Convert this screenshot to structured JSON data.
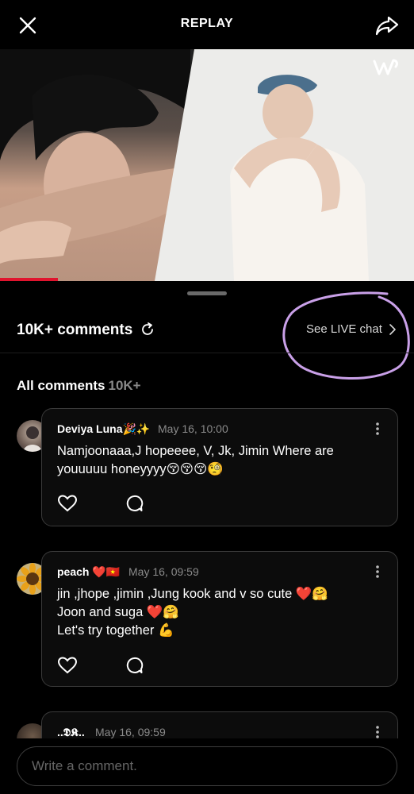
{
  "header": {
    "title": "REPLAY",
    "close_icon": "close-icon",
    "share_icon": "share-icon"
  },
  "video": {
    "logo_icon": "weverse-logo-icon",
    "progress": 0.14
  },
  "comments_section": {
    "count_label": "10K+ comments",
    "refresh_icon": "refresh-icon",
    "live_chat_label": "See LIVE chat",
    "all_comments_label": "All comments",
    "all_comments_count": "10K+"
  },
  "comments": [
    {
      "author": "Deviya Luna🎉✨",
      "date": "May 16, 10:00",
      "lines": [
        "Namjoonaaa,J hopeeee, V, Jk, Jimin Where are",
        "youuuuu honeyyyy😚😚😚🧐"
      ]
    },
    {
      "author": "peach ❤️🇻🇳",
      "date": "May 16, 09:59",
      "lines": [
        "jin ,jhope ,jimin ,Jung kook and v so cute ❤️🤗",
        "Joon and suga ❤️🤗",
        "Let's try together 💪"
      ]
    },
    {
      "author": "..𝕯𝕶..",
      "date": "May 16, 09:59",
      "lines": []
    }
  ],
  "composer": {
    "placeholder": "Write a comment."
  },
  "colors": {
    "background": "#000000",
    "progress": "#e0142e",
    "annotation": "#c9a0e8"
  }
}
